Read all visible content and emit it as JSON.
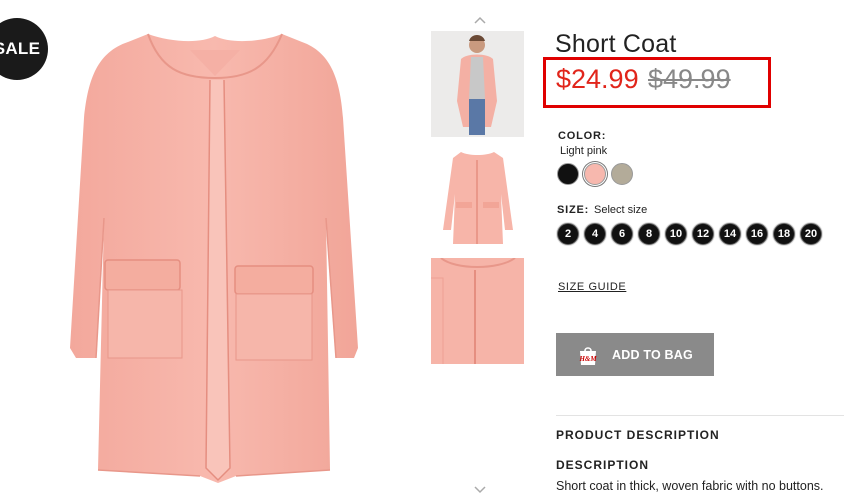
{
  "badge": {
    "label": "SALE"
  },
  "product": {
    "title": "Short Coat",
    "price_sale": "$24.99",
    "price_original": "$49.99"
  },
  "color": {
    "label": "COLOR:",
    "selected": "Light pink",
    "swatches": [
      {
        "name": "black",
        "hex": "#111111"
      },
      {
        "name": "light-pink",
        "hex": "#f7b8ae"
      },
      {
        "name": "grey-beige",
        "hex": "#b3ab99"
      }
    ]
  },
  "size": {
    "label": "SIZE:",
    "hint": "Select size",
    "options": [
      "2",
      "4",
      "6",
      "8",
      "10",
      "12",
      "14",
      "16",
      "18",
      "20"
    ]
  },
  "size_guide": "SIZE GUIDE",
  "add_to_bag": {
    "label": "ADD TO BAG",
    "icon": "hm-bag-icon",
    "bg": "#8a8a8a"
  },
  "product_description": {
    "heading": "PRODUCT DESCRIPTION",
    "subheading": "DESCRIPTION",
    "text": "Short coat in thick, woven fabric with no buttons."
  },
  "colors": {
    "price_sale": "#e1251b",
    "highlight_box": "#e00000",
    "coat": "#f7b3a8"
  }
}
